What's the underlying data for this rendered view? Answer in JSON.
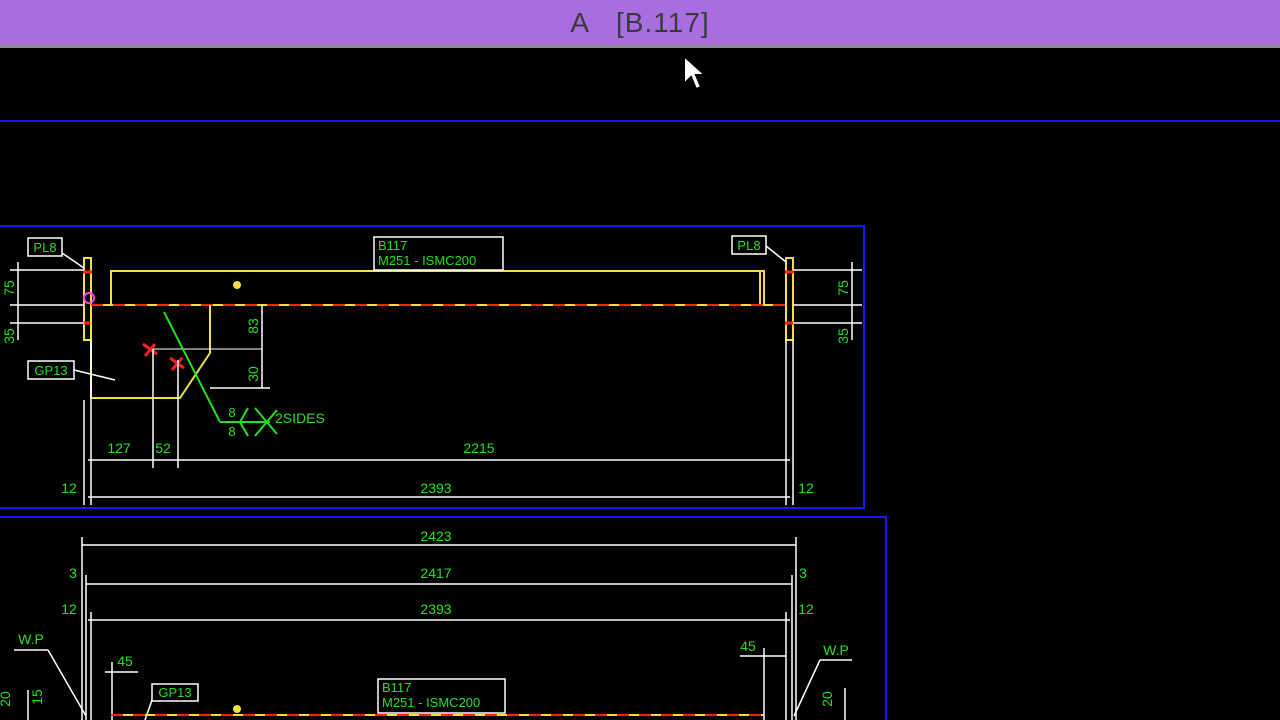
{
  "window": {
    "title_left": "A",
    "title_right": "[B.117]"
  },
  "view1": {
    "tags": {
      "pl_left": "PL8",
      "pl_right": "PL8",
      "gusset": "GP13",
      "beam_mark": "B117",
      "beam_section": "M251 - ISMC200"
    },
    "weld": {
      "size_top": "8",
      "size_bottom": "8",
      "note": "2SIDES"
    },
    "dims": {
      "d75_left": "75",
      "d35_left": "35",
      "d75_right": "75",
      "d35_right": "35",
      "d83": "83",
      "d30": "30",
      "d127": "127",
      "d52": "52",
      "d2215": "2215",
      "d12_left": "12",
      "d2393": "2393",
      "d12_right": "12"
    }
  },
  "view2": {
    "tags": {
      "beam_mark": "B117",
      "beam_section": "M251 - ISMC200",
      "gusset": "GP13",
      "wp_left": "W.P",
      "wp_right": "W.P"
    },
    "dims": {
      "d2423": "2423",
      "d3_left": "3",
      "d2417": "2417",
      "d3_right": "3",
      "d12_left": "12",
      "d2393": "2393",
      "d12_right": "12",
      "d45_left": "45",
      "d45_right": "45",
      "d15": "15",
      "d20_left": "20",
      "d20_right": "20"
    }
  },
  "colors": {
    "title_bar": "#a86de0",
    "frame": "#1515ff",
    "steel": "#f0e040",
    "dimension_text": "#22e022",
    "dimension_line": "#ffffff",
    "center_line": "#ff2020",
    "weld_symbol": "#22e022"
  }
}
